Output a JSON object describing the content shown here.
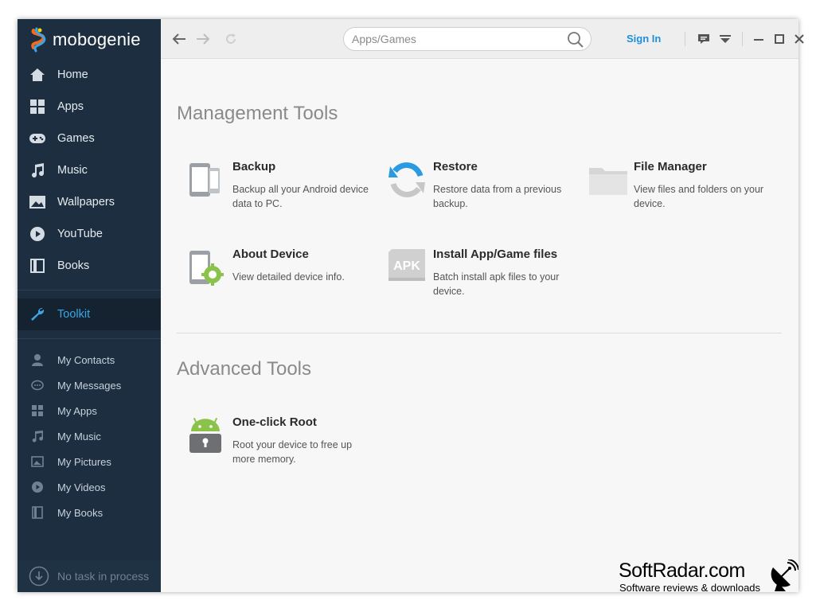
{
  "app": {
    "name": "mobogenie"
  },
  "sidebar": {
    "items": [
      {
        "label": "Home",
        "icon": "home-icon"
      },
      {
        "label": "Apps",
        "icon": "apps-grid-icon"
      },
      {
        "label": "Games",
        "icon": "gamepad-icon"
      },
      {
        "label": "Music",
        "icon": "music-note-icon"
      },
      {
        "label": "Wallpapers",
        "icon": "wallpaper-icon"
      },
      {
        "label": "YouTube",
        "icon": "play-icon"
      },
      {
        "label": "Books",
        "icon": "book-icon"
      }
    ],
    "active": {
      "label": "Toolkit",
      "icon": "wrench-icon"
    },
    "sub_items": [
      {
        "label": "My Contacts",
        "icon": "person-icon"
      },
      {
        "label": "My Messages",
        "icon": "message-icon"
      },
      {
        "label": "My Apps",
        "icon": "apps-grid-icon"
      },
      {
        "label": "My Music",
        "icon": "music-note-icon"
      },
      {
        "label": "My Pictures",
        "icon": "picture-icon"
      },
      {
        "label": "My Videos",
        "icon": "play-icon"
      },
      {
        "label": "My Books",
        "icon": "book-icon"
      }
    ],
    "task_status": "No task in process"
  },
  "topbar": {
    "search_placeholder": "Apps/Games",
    "sign_in": "Sign In"
  },
  "main": {
    "management_title": "Management Tools",
    "management_tools": [
      {
        "name": "Backup",
        "desc": "Backup all your Android device data to PC."
      },
      {
        "name": "Restore",
        "desc": "Restore data from a previous backup."
      },
      {
        "name": "File Manager",
        "desc": "View files and folders on your device."
      },
      {
        "name": "About Device",
        "desc": "View detailed device info."
      },
      {
        "name": "Install App/Game files",
        "desc": "Batch install apk files to your device.",
        "icon_text": "APK"
      }
    ],
    "advanced_title": "Advanced Tools",
    "advanced_tools": [
      {
        "name": "One-click Root",
        "desc": "Root your device to free up more memory."
      }
    ]
  },
  "watermark": {
    "title": "SoftRadar.com",
    "subtitle": "Software reviews & downloads"
  },
  "colors": {
    "sidebar_bg": "#1c2e3f",
    "accent": "#1e90d8",
    "android_green": "#8bc34a"
  }
}
